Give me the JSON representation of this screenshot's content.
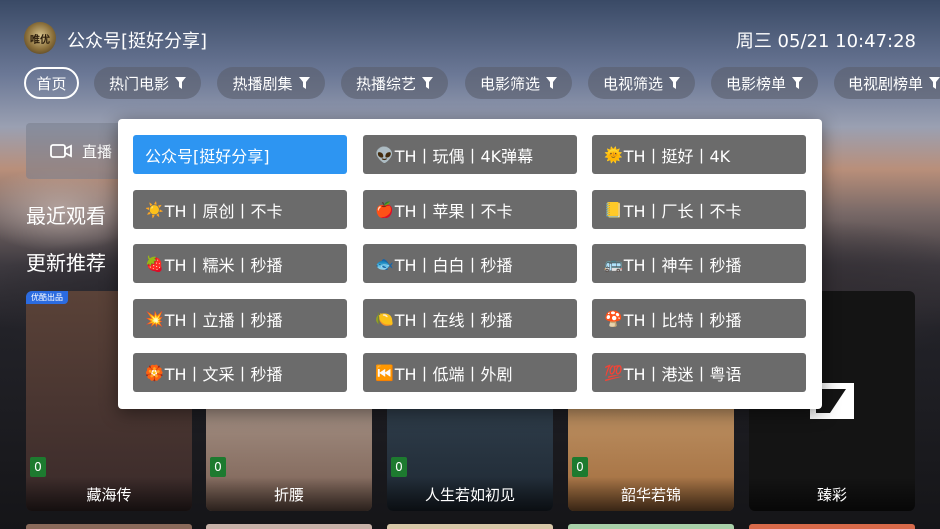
{
  "header": {
    "logo_text": "唯优",
    "title": "公众号[挺好分享]",
    "datetime": "周三 05/21 10:47:28"
  },
  "tabs": [
    {
      "label": "首页",
      "filter": false,
      "active": true
    },
    {
      "label": "热门电影",
      "filter": true
    },
    {
      "label": "热播剧集",
      "filter": true
    },
    {
      "label": "热播综艺",
      "filter": true
    },
    {
      "label": "电影筛选",
      "filter": true
    },
    {
      "label": "电视筛选",
      "filter": true
    },
    {
      "label": "电影榜单",
      "filter": true
    },
    {
      "label": "电视剧榜单",
      "filter": true
    }
  ],
  "live_button": {
    "label": "直播",
    "icon": "video-camera-icon"
  },
  "sections": {
    "recent": "最近观看",
    "recommend": "更新推荐"
  },
  "cards": [
    {
      "title": "藏海传",
      "score": "0",
      "badge": "优酷出品",
      "color_top": "#5a4238",
      "color_bottom": "#3a2a2a"
    },
    {
      "title": "折腰",
      "score": "0",
      "badge": "",
      "color_top": "#cfc3b8",
      "color_bottom": "#7a5f52"
    },
    {
      "title": "人生若如初见",
      "score": "0",
      "badge": "",
      "color_top": "#415463",
      "color_bottom": "#1e2833"
    },
    {
      "title": "韶华若锦",
      "score": "0",
      "badge": "",
      "color_top": "#d9b98c",
      "color_bottom": "#a16b3c"
    },
    {
      "title": "臻彩",
      "score": "",
      "badge": "",
      "color_top": "#141414",
      "color_bottom": "#141414"
    }
  ],
  "popup": {
    "selected_index": 0,
    "options": [
      {
        "emoji": "",
        "text": "公众号[挺好分享]"
      },
      {
        "emoji": "👽",
        "text": "TH丨玩偶丨4K弹幕"
      },
      {
        "emoji": "🌞",
        "text": "TH丨挺好丨4K"
      },
      {
        "emoji": "☀️",
        "text": "TH丨原创丨不卡"
      },
      {
        "emoji": "🍎",
        "text": "TH丨苹果丨不卡"
      },
      {
        "emoji": "📒",
        "text": "TH丨厂长丨不卡"
      },
      {
        "emoji": "🍓",
        "text": "TH丨糯米丨秒播"
      },
      {
        "emoji": "🐟",
        "text": "TH丨白白丨秒播"
      },
      {
        "emoji": "🚌",
        "text": "TH丨神车丨秒播"
      },
      {
        "emoji": "💥",
        "text": "TH丨立播丨秒播"
      },
      {
        "emoji": "🍋",
        "text": "TH丨在线丨秒播"
      },
      {
        "emoji": "🍄",
        "text": "TH丨比特丨秒播"
      },
      {
        "emoji": "🏵️",
        "text": "TH丨文采丨秒播"
      },
      {
        "emoji": "⏮️",
        "text": "TH丨低端丨外剧"
      },
      {
        "emoji": "💯",
        "text": "TH丨港迷丨粤语"
      }
    ]
  },
  "colors": {
    "selected": "#2d95f2",
    "option_bg": "#6b6b6b",
    "score_bg": "#1d7a2f"
  }
}
